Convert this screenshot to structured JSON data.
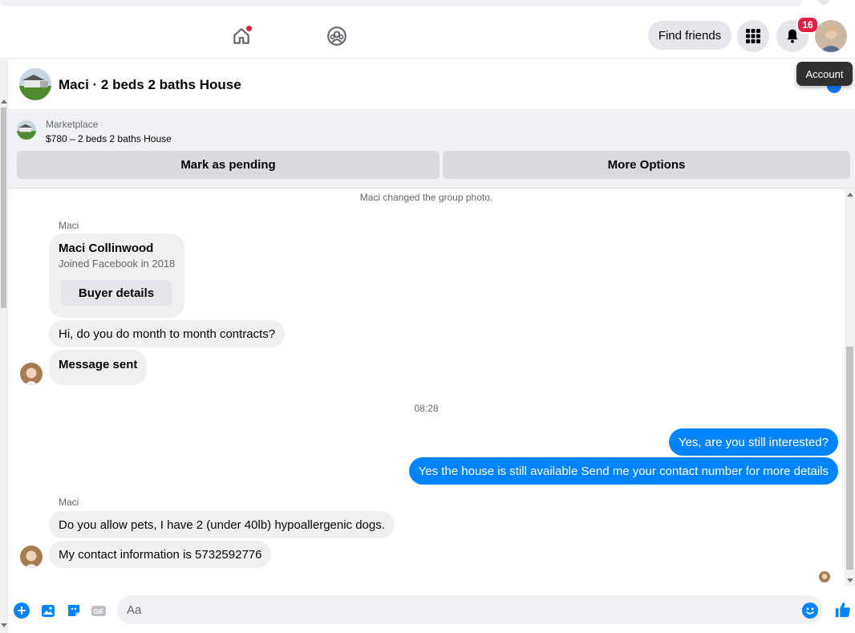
{
  "nav": {
    "find_friends": "Find friends",
    "notifications_count": "16",
    "tooltip": "Account"
  },
  "chat": {
    "title": "Maci · 2 beds 2 baths House"
  },
  "marketplace": {
    "label": "Marketplace",
    "item": "$780 – 2 beds 2 baths House",
    "mark_pending": "Mark as pending",
    "more_options": "More Options"
  },
  "messages": {
    "system_note": "Maci changed the group photo.",
    "sender1": "Maci",
    "card_name": "Maci Collinwood",
    "card_sub": "Joined Facebook in 2018",
    "buyer_details": "Buyer details",
    "msg1": "Hi, do you do month to month contracts?",
    "msg2": "Message sent",
    "timestamp": "08:28",
    "out1": "Yes, are you still interested?",
    "out2": "Yes the house is still available Send me your contact number for more details",
    "sender2": "Maci",
    "msg3": "Do you allow pets, I have 2 (under 40lb) hypoallergenic dogs.",
    "msg4": "My contact information is 5732592776"
  },
  "composer": {
    "placeholder": "Aa"
  },
  "colors": {
    "accent": "#0084ff",
    "brand": "#1877f2",
    "badge": "#e41e3f"
  }
}
